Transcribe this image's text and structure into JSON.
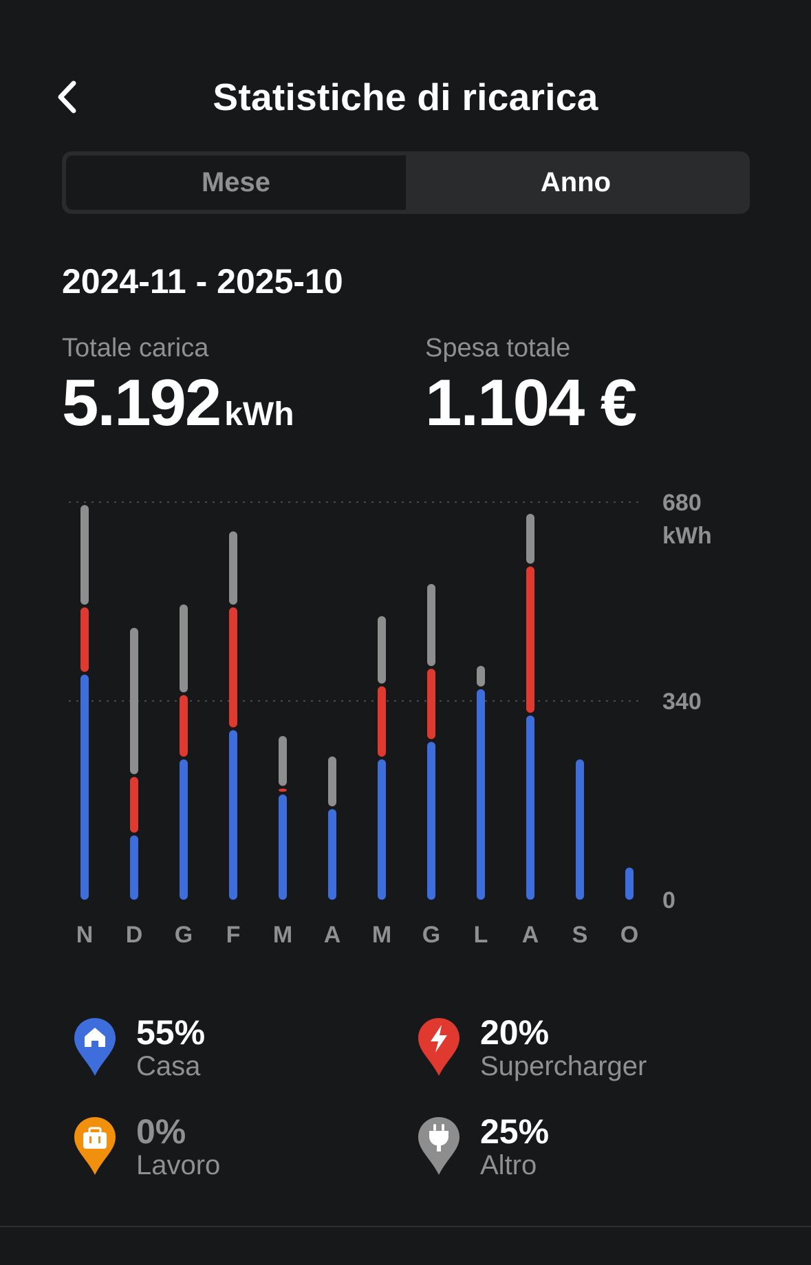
{
  "header": {
    "title": "Statistiche di ricarica"
  },
  "tabs": [
    {
      "label": "Mese",
      "selected": false
    },
    {
      "label": "Anno",
      "selected": true
    }
  ],
  "range": "2024-11 - 2025-10",
  "totals": {
    "charge_label": "Totale carica",
    "charge_value": "5.192",
    "charge_unit": "kWh",
    "spend_label": "Spesa totale",
    "spend_value": "1.104 €"
  },
  "chart_data": {
    "type": "bar",
    "stacked": true,
    "categories": [
      "N",
      "D",
      "G",
      "F",
      "M",
      "A",
      "M",
      "G",
      "L",
      "A",
      "S",
      "O"
    ],
    "series": [
      {
        "name": "Casa",
        "color": "#3e6ddc",
        "values": [
          385,
          110,
          240,
          290,
          180,
          155,
          240,
          270,
          360,
          315,
          240,
          55
        ]
      },
      {
        "name": "Supercharger",
        "color": "#e0392f",
        "values": [
          115,
          100,
          110,
          210,
          10,
          0,
          125,
          125,
          0,
          255,
          0,
          0
        ]
      },
      {
        "name": "Altro",
        "color": "#8e8e8e",
        "values": [
          175,
          255,
          155,
          130,
          90,
          90,
          120,
          145,
          40,
          90,
          0,
          0
        ]
      }
    ],
    "ylim": [
      0,
      680
    ],
    "yticks": [
      "0",
      "340",
      "680"
    ],
    "yunit": "kWh",
    "gridlines": [
      340,
      680
    ]
  },
  "legend": [
    {
      "pct": "55%",
      "name": "Casa",
      "color": "#3e6ddc",
      "icon": "home-icon"
    },
    {
      "pct": "20%",
      "name": "Supercharger",
      "color": "#e0392f",
      "icon": "bolt-icon"
    },
    {
      "pct": "0%",
      "name": "Lavoro",
      "color": "#f0900c",
      "icon": "briefcase-icon"
    },
    {
      "pct": "25%",
      "name": "Altro",
      "color": "#8e8e8e",
      "icon": "plug-icon"
    }
  ]
}
